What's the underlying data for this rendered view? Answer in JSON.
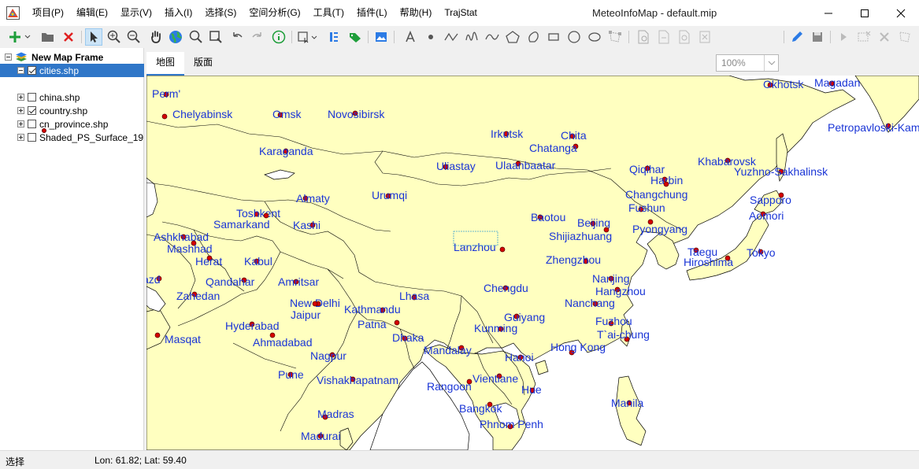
{
  "app": {
    "title": "MeteoInfoMap - default.mip",
    "colors": {
      "accent": "#2f76c8",
      "land": "#ffffc0",
      "city_point": "#d40000",
      "label": "#1a35d6"
    }
  },
  "menu": [
    "项目(P)",
    "编辑(E)",
    "显示(V)",
    "插入(I)",
    "选择(S)",
    "空间分析(G)",
    "工具(T)",
    "插件(L)",
    "帮助(H)",
    "TrajStat"
  ],
  "toolbar": {
    "zoom": "100%"
  },
  "legend": {
    "frame": "New Map Frame",
    "layers": [
      {
        "name": "cities.shp",
        "checked": true,
        "selected": true
      },
      {
        "name": "china.shp",
        "checked": false
      },
      {
        "name": "country.shp",
        "checked": true
      },
      {
        "name": "cn_province.shp",
        "checked": false
      },
      {
        "name": "Shaded_PS_Surface_19",
        "checked": false
      }
    ]
  },
  "tabs": [
    "地图",
    "版面"
  ],
  "cities": [
    {
      "name": "Perm'"
    },
    {
      "name": "Chelyabinsk"
    },
    {
      "name": "Omsk"
    },
    {
      "name": "Novosibirsk"
    },
    {
      "name": "Irkutsk"
    },
    {
      "name": "Chita"
    },
    {
      "name": "Chatanga"
    },
    {
      "name": "Okhotsk"
    },
    {
      "name": "Magadan"
    },
    {
      "name": "Petropavloski-Kam"
    },
    {
      "name": "Karaganda"
    },
    {
      "name": "Uliastay"
    },
    {
      "name": "Ulaanbaatar"
    },
    {
      "name": "Khabarovsk"
    },
    {
      "name": "Yuzhno-Sakhalinsk"
    },
    {
      "name": "Qiqihar"
    },
    {
      "name": "Harbin"
    },
    {
      "name": "Changchung"
    },
    {
      "name": "Fushun"
    },
    {
      "name": "Sapporo"
    },
    {
      "name": "Aomori"
    },
    {
      "name": "Almaty"
    },
    {
      "name": "Urumqi"
    },
    {
      "name": "Toshkent"
    },
    {
      "name": "Samarkand"
    },
    {
      "name": "Kashi"
    },
    {
      "name": "Baotou"
    },
    {
      "name": "Beijing"
    },
    {
      "name": "Shijiazhuang"
    },
    {
      "name": "Pyongyang"
    },
    {
      "name": "Ashkhabad"
    },
    {
      "name": "Mashhad"
    },
    {
      "name": "Herat"
    },
    {
      "name": "Kabul"
    },
    {
      "name": "Lanzhou"
    },
    {
      "name": "Taegu"
    },
    {
      "name": "Hiroshima"
    },
    {
      "name": "Tokyo"
    },
    {
      "name": "Zhengzhou"
    },
    {
      "name": "azd"
    },
    {
      "name": "Qandahar"
    },
    {
      "name": "Amritsar"
    },
    {
      "name": "Chengdu"
    },
    {
      "name": "Nanjing"
    },
    {
      "name": "Hangzhou"
    },
    {
      "name": "Zahedan"
    },
    {
      "name": "Lhasa"
    },
    {
      "name": "New Delhi"
    },
    {
      "name": "Nanchang"
    },
    {
      "name": "Jaipur"
    },
    {
      "name": "Kathmandu"
    },
    {
      "name": "Guiyang"
    },
    {
      "name": "Fuzhou"
    },
    {
      "name": "Hyderabad"
    },
    {
      "name": "Patna"
    },
    {
      "name": "T`ai-chung"
    },
    {
      "name": "Masqat"
    },
    {
      "name": "Kunming"
    },
    {
      "name": "Ahmadabad"
    },
    {
      "name": "Dhaka"
    },
    {
      "name": "Hong Kong"
    },
    {
      "name": "Mandalay"
    },
    {
      "name": "Nagpur"
    },
    {
      "name": "Hanoi"
    },
    {
      "name": "Pune"
    },
    {
      "name": "Vientiane"
    },
    {
      "name": "Vishakhapatnam"
    },
    {
      "name": "Rangoon"
    },
    {
      "name": "Hue"
    },
    {
      "name": "Manila"
    },
    {
      "name": "Bangkok"
    },
    {
      "name": "Madras"
    },
    {
      "name": "Phnom Penh"
    },
    {
      "name": "Madurai"
    }
  ],
  "status": {
    "mode": "选择",
    "coords": "Lon: 61.82; Lat: 59.40"
  }
}
